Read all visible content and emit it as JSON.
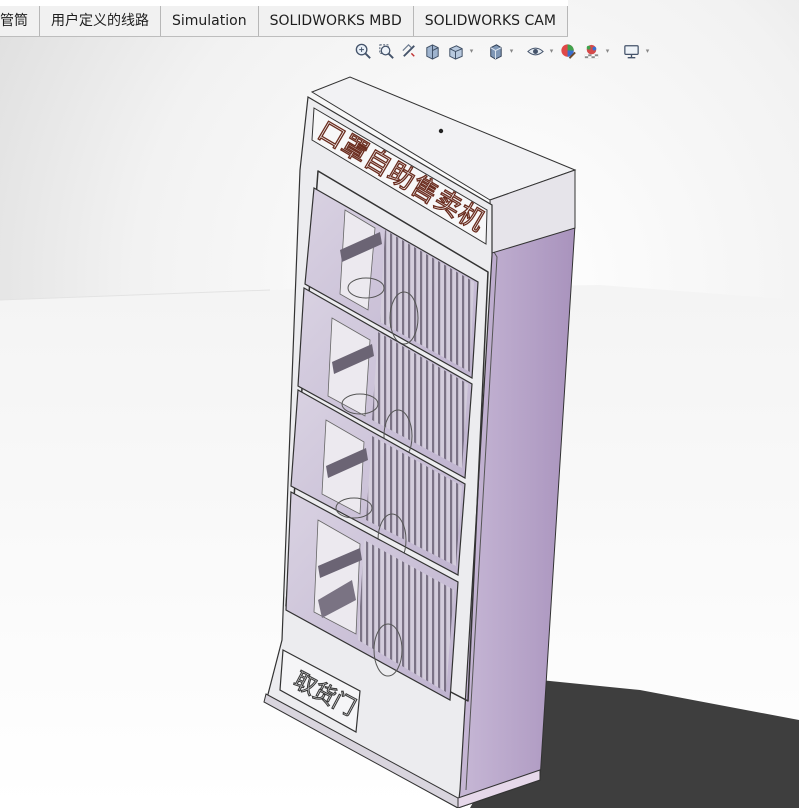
{
  "command_manager": {
    "tabs": [
      {
        "label": "管筒"
      },
      {
        "label": "用户定义的线路"
      },
      {
        "label": "Simulation"
      },
      {
        "label": "SOLIDWORKS MBD"
      },
      {
        "label": "SOLIDWORKS CAM"
      }
    ]
  },
  "heads_up_toolbar": {
    "tools": [
      {
        "icon": "zoom-to-fit-icon"
      },
      {
        "icon": "zoom-to-area-icon"
      },
      {
        "icon": "previous-view-icon"
      },
      {
        "icon": "section-view-icon"
      },
      {
        "icon": "view-orientation-icon"
      },
      {
        "icon": "display-style-icon"
      },
      {
        "icon": "hide-show-items-icon"
      },
      {
        "icon": "edit-appearance-icon"
      },
      {
        "icon": "apply-scene-icon"
      },
      {
        "icon": "view-settings-icon"
      }
    ]
  },
  "model": {
    "sign_label": "口罩自助售卖机",
    "pickup_door_label": "取货门",
    "colors": {
      "body": "#c9c0d6",
      "side": "#b9a8c9",
      "frame": "#e9e9ee",
      "glass": "#cfc6d8",
      "sign_text": "#7a3a2a",
      "shadow": "#404040"
    }
  }
}
